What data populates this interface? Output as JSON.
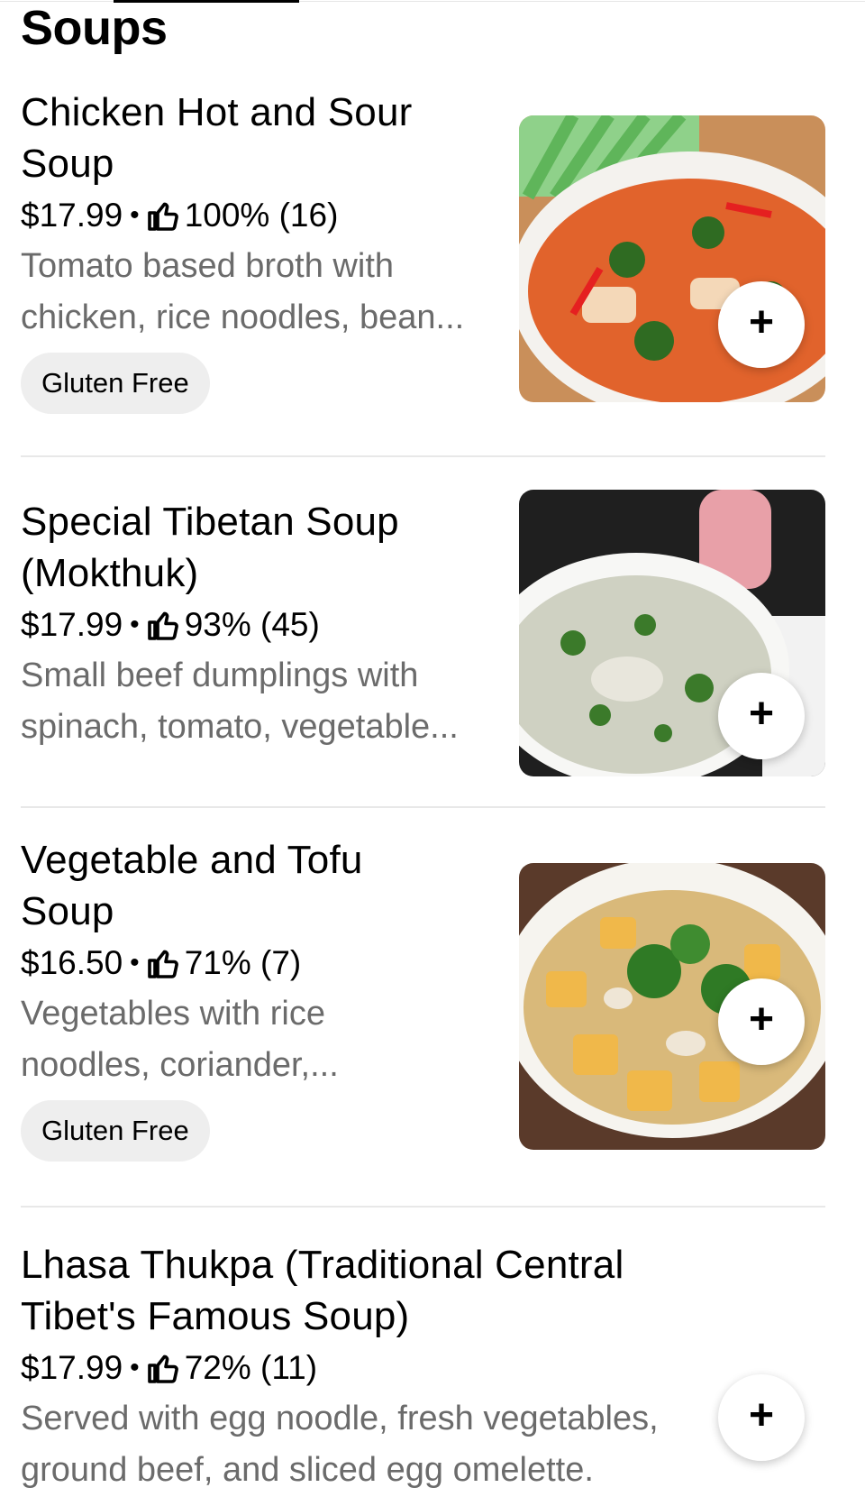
{
  "section": {
    "title": "Soups"
  },
  "items": [
    {
      "name": "Chicken Hot and Sour Soup",
      "price": "$17.99",
      "rating": "100% (16)",
      "description_line1": "Tomato based broth with",
      "description_line2": "chicken, rice noodles, bean...",
      "badge": "Gluten Free",
      "add_label": "+"
    },
    {
      "name": "Special Tibetan Soup (Mokthuk)",
      "price": "$17.99",
      "rating": "93% (45)",
      "description_line1": "Small beef dumplings with",
      "description_line2": "spinach, tomato, vegetable...",
      "add_label": "+"
    },
    {
      "name": "Vegetable and Tofu Soup",
      "price": "$16.50",
      "rating": "71% (7)",
      "description_line1": "Vegetables with rice",
      "description_line2": "noodles, coriander,...",
      "badge": "Gluten Free",
      "add_label": "+"
    },
    {
      "name": "Lhasa Thukpa (Traditional Central Tibet's Famous Soup)",
      "price": "$17.99",
      "rating": "72% (11)",
      "description_line1": "Served with egg noodle, fresh vegetables,",
      "description_line2": "ground beef, and sliced egg omelette.",
      "add_label": "+"
    }
  ],
  "price_separator": "•",
  "colors": {
    "text": "#000000",
    "muted": "#6b6b6b",
    "badge_bg": "#eeeeee",
    "divider": "#e8e8e8"
  },
  "icons": {
    "rating": "thumbs-up-icon",
    "add": "plus-icon"
  }
}
